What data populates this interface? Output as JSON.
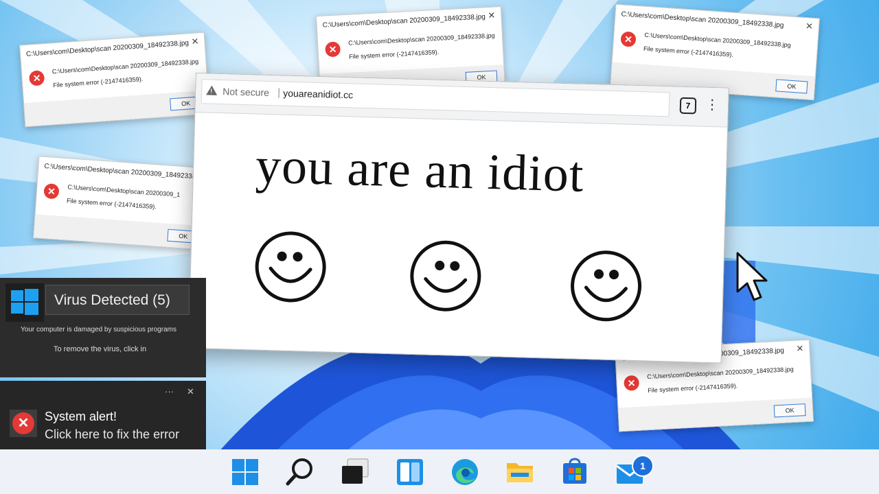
{
  "dialogs": [
    {
      "title": "C:\\Users\\com\\Desktop\\scan 20200309_18492338.jpg",
      "close": "✕",
      "path": "C:\\Users\\com\\Desktop\\scan 20200309_18492338.jpg",
      "message": "File system error (-2147416359).",
      "ok": "OK",
      "icon": "✕"
    },
    {
      "title": "C:\\Users\\com\\Desktop\\scan 20200309_18492338.jpg",
      "close": "✕",
      "path": "C:\\Users\\com\\Desktop\\scan 20200309_18492338.jpg",
      "message": "File system error (-2147416359).",
      "ok": "OK",
      "icon": "✕"
    },
    {
      "title": "C:\\Users\\com\\Desktop\\scan 20200309_18492338.jpg",
      "close": "✕",
      "path": "C:\\Users\\com\\Desktop\\scan 20200309_18492338.jpg",
      "message": "File system error (-2147416359).",
      "ok": "OK",
      "icon": "✕"
    },
    {
      "title": "C:\\Users\\com\\Desktop\\scan 20200309_18492338.jpg",
      "close": "✕",
      "path": "C:\\Users\\com\\Desktop\\scan 20200309_1",
      "message": "File system error (-2147416359).",
      "ok": "OK",
      "icon": "✕"
    },
    {
      "title": "C:\\Users\\com\\Desktop\\scan 20200309_18492338.jpg",
      "close": "✕",
      "path": "C:\\Users\\com\\Desktop\\scan 20200309_18492338.jpg",
      "message": "File system error (-2147416359).",
      "ok": "OK",
      "icon": "✕"
    }
  ],
  "browser": {
    "security_label": "Not secure",
    "separator": "|",
    "url": "youareanidiot.cc",
    "tab_count": "7",
    "menu_icon": "⋮",
    "headline": "you are an idiot"
  },
  "virus_panel": {
    "title": "Virus Detected (5)",
    "line1": "Your computer is damaged by suspicious programs",
    "line2": "To remove the virus, click in"
  },
  "system_alert": {
    "more": "···",
    "close": "✕",
    "title": "System alert!",
    "message": "Click here to fix the error",
    "icon": "✕"
  },
  "taskbar": {
    "items": [
      "start-icon",
      "search-icon",
      "task-view-icon",
      "widgets-icon",
      "edge-icon",
      "file-explorer-icon",
      "store-icon",
      "mail-icon"
    ],
    "mail_badge": "1"
  },
  "colors": {
    "error_red": "#e53935",
    "accent_blue": "#1e6fd9",
    "panel_dark": "#2c2c2c",
    "taskbar_bg": "#eef2f8"
  }
}
